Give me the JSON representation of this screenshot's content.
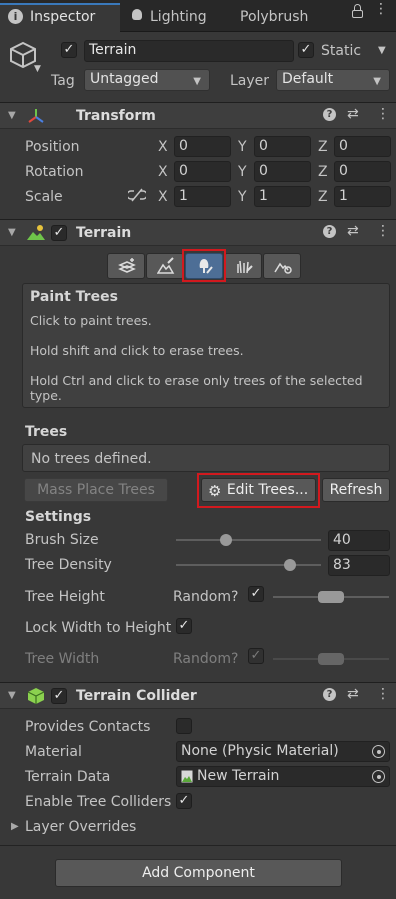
{
  "tabs": [
    {
      "label": "Inspector",
      "icon": "info-icon",
      "active": true
    },
    {
      "label": "Lighting",
      "icon": "lightbulb-icon",
      "active": false
    },
    {
      "label": "Polybrush",
      "icon": "",
      "active": false
    }
  ],
  "object": {
    "name": "Terrain",
    "static_label": "Static",
    "tag_label": "Tag",
    "tag_value": "Untagged",
    "layer_label": "Layer",
    "layer_value": "Default"
  },
  "transform": {
    "title": "Transform",
    "rows": [
      {
        "label": "Position",
        "x": "0",
        "y": "0",
        "z": "0"
      },
      {
        "label": "Rotation",
        "x": "0",
        "y": "0",
        "z": "0"
      },
      {
        "label": "Scale",
        "x": "1",
        "y": "1",
        "z": "1"
      }
    ],
    "axes": {
      "x": "X",
      "y": "Y",
      "z": "Z"
    }
  },
  "terrain": {
    "title": "Terrain",
    "tools": [
      "create-neighbor-terrains-icon",
      "paint-terrain-icon",
      "paint-trees-icon",
      "paint-details-icon",
      "terrain-settings-icon"
    ],
    "selected_tool": 2,
    "help": {
      "title": "Paint Trees",
      "line1": "Click to paint trees.",
      "line2": "Hold shift and click to erase trees.",
      "line3": "Hold Ctrl and click to erase only trees of the selected",
      "line4": "type."
    },
    "trees_label": "Trees",
    "no_trees": "No trees defined.",
    "mass_place": "Mass Place Trees",
    "edit_trees": "Edit Trees...",
    "refresh": "Refresh",
    "settings_label": "Settings",
    "brush_size_label": "Brush Size",
    "brush_size": "40",
    "brush_size_fraction": 0.3,
    "tree_density_label": "Tree Density",
    "tree_density": "83",
    "tree_density_fraction": 0.83,
    "tree_height_label": "Tree Height",
    "random_label": "Random?",
    "lock_width_label": "Lock Width to Height",
    "tree_width_label": "Tree Width",
    "random_label_2": "Random?"
  },
  "collider": {
    "title": "Terrain Collider",
    "provides_contacts": "Provides Contacts",
    "material_label": "Material",
    "material_value": "None (Physic Material)",
    "terrain_data_label": "Terrain Data",
    "terrain_data_value": "New Terrain",
    "enable_tree_colliders": "Enable Tree Colliders",
    "layer_overrides": "Layer Overrides"
  },
  "add_component": "Add Component",
  "colors": {
    "highlight": "#d2191e",
    "selected_tool": "#4d6e96"
  }
}
